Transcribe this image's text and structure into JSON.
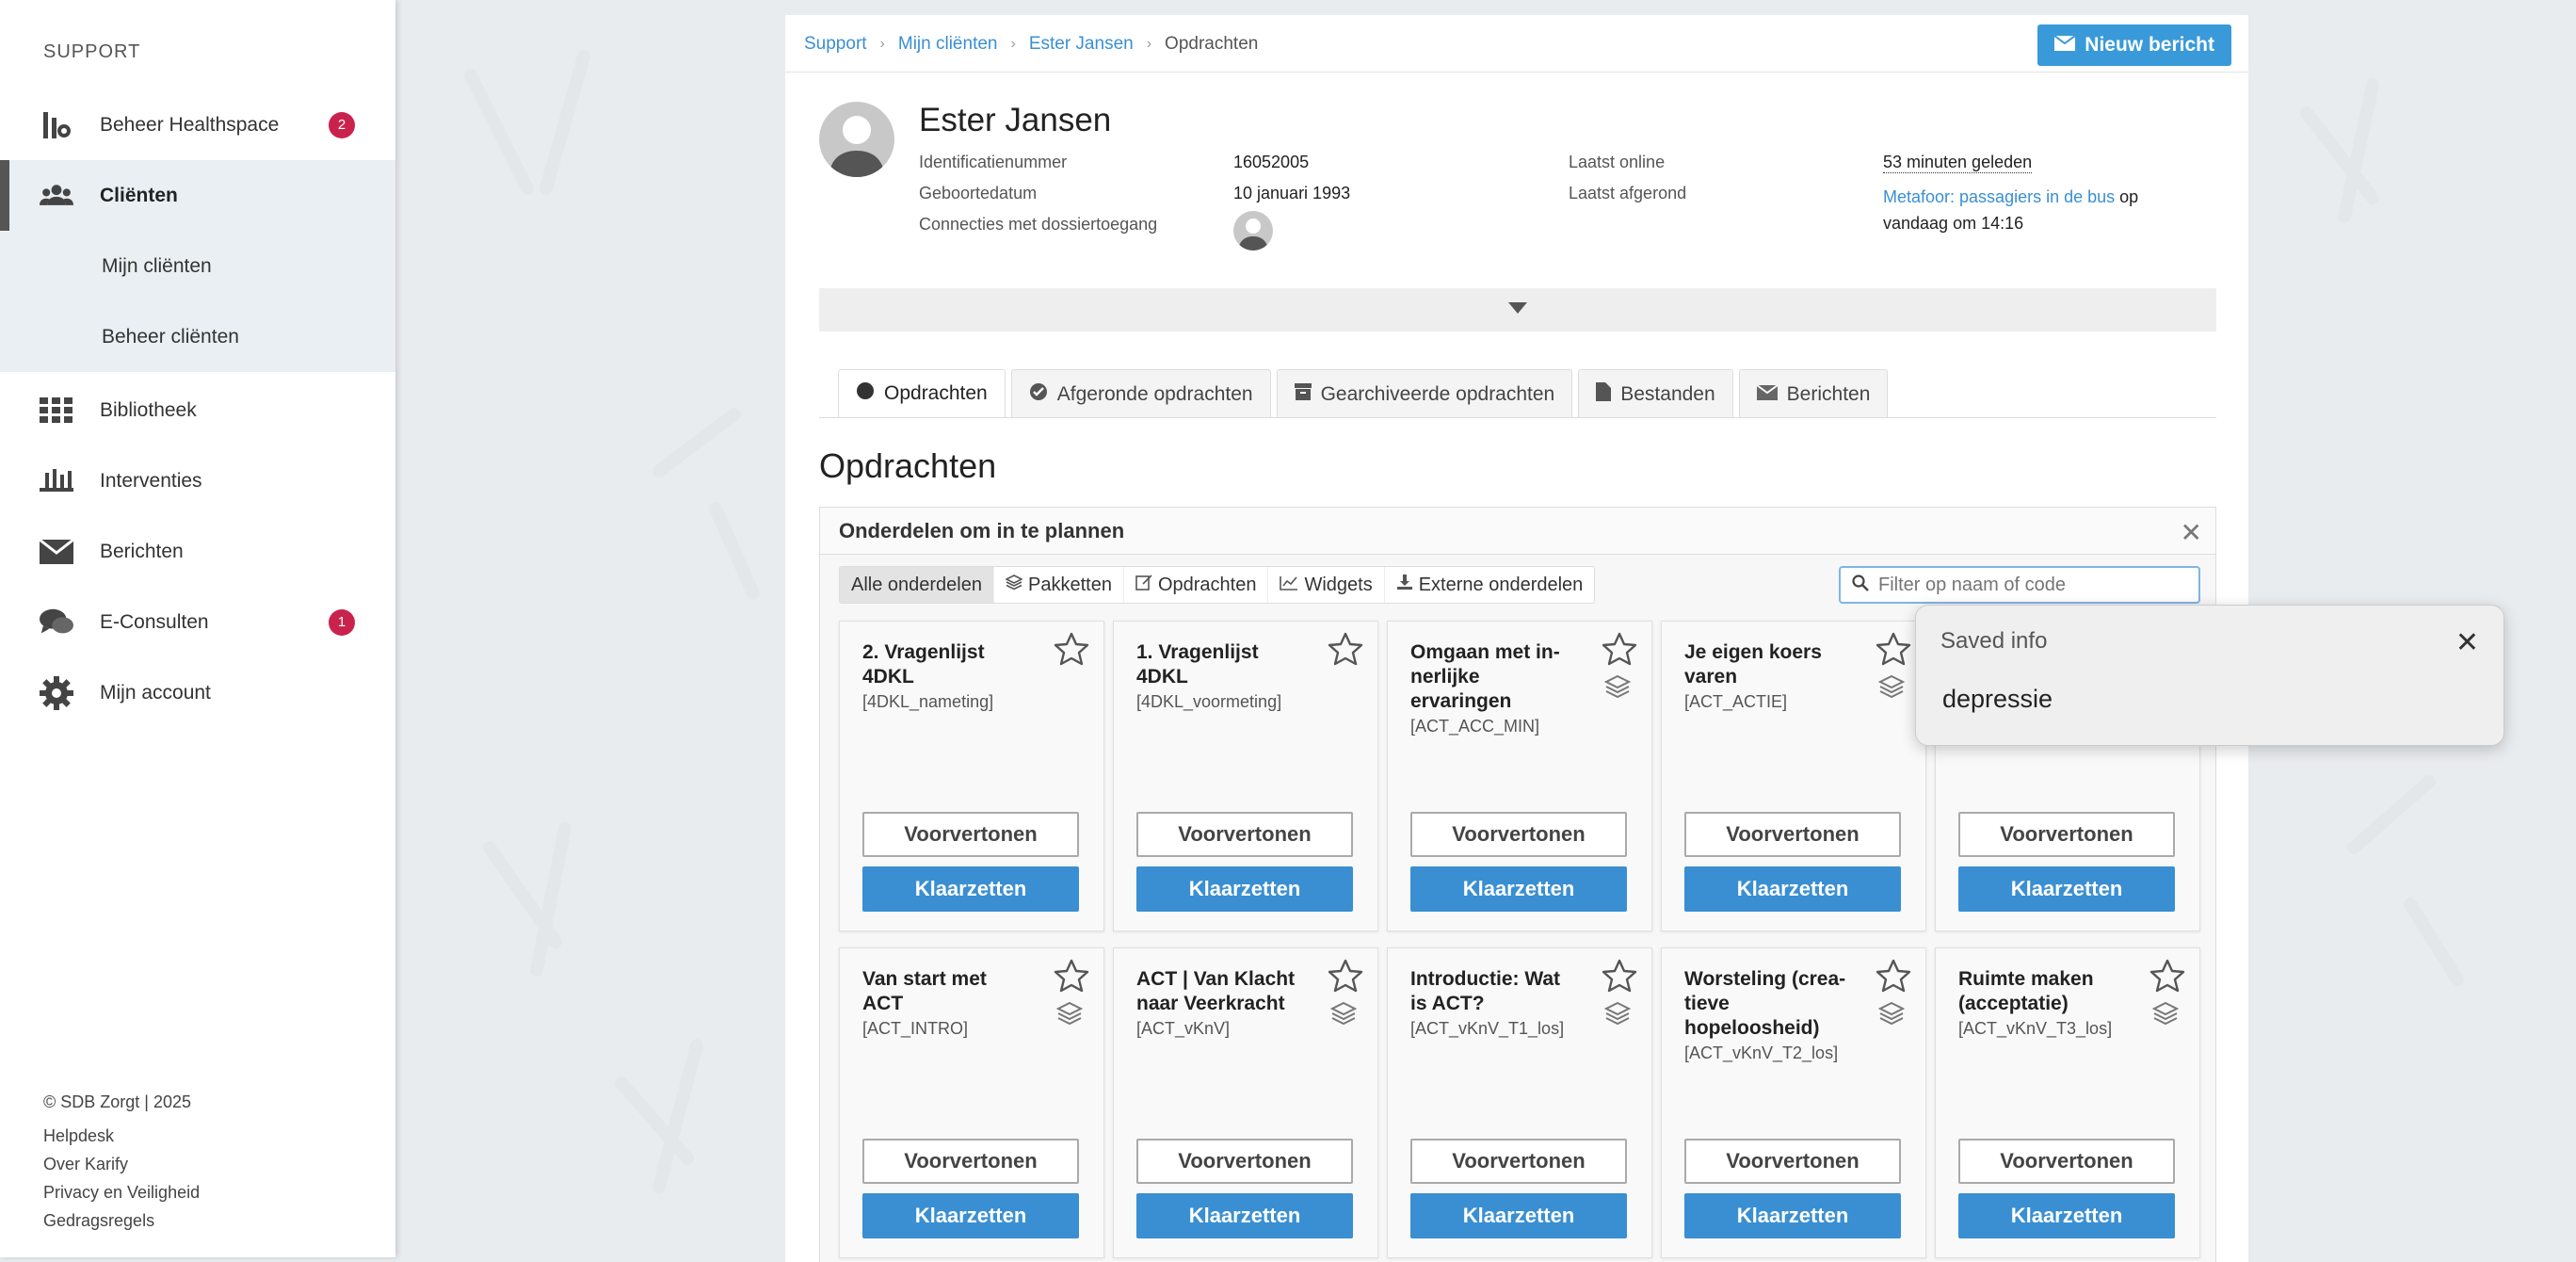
{
  "sidebar": {
    "section": "SUPPORT",
    "items": [
      {
        "label": "Beheer Healthspace",
        "badge": "2"
      },
      {
        "label": "Cliënten"
      },
      {
        "label": "Mijn cliënten"
      },
      {
        "label": "Beheer cliënten"
      },
      {
        "label": "Bibliotheek"
      },
      {
        "label": "Interventies"
      },
      {
        "label": "Berichten"
      },
      {
        "label": "E-Consulten",
        "badge": "1"
      },
      {
        "label": "Mijn account"
      }
    ],
    "footer": {
      "copyright": "© SDB Zorgt | 2025",
      "links": [
        "Helpdesk",
        "Over Karify",
        "Privacy en Veiligheid",
        "Gedragsregels"
      ]
    }
  },
  "breadcrumb": [
    "Support",
    "Mijn cliënten",
    "Ester Jansen",
    "Opdrachten"
  ],
  "new_message_label": "Nieuw bericht",
  "client": {
    "name": "Ester Jansen",
    "id_label": "Identificatienummer",
    "id_value": "16052005",
    "dob_label": "Geboortedatum",
    "dob_value": "10 januari 1993",
    "connections_label": "Connecties met dossiertoegang",
    "last_online_label": "Laatst online",
    "last_online_value": "53 minuten geleden",
    "last_done_label": "Laatst afgerond",
    "last_done_link": "Metafoor: passagiers in de bus",
    "last_done_suffix": " op",
    "last_done_time": "vandaag om 14:16"
  },
  "tabs": [
    "Opdrachten",
    "Afgeronde opdrachten",
    "Gearchiveerde opdrachten",
    "Bestanden",
    "Berichten"
  ],
  "section_title": "Opdrachten",
  "panel": {
    "title": "Onderdelen om in te plannen",
    "filter_tabs": [
      "Alle onderdelen",
      "Pakketten",
      "Opdrachten",
      "Widgets",
      "Externe onderdelen"
    ],
    "search_placeholder": "Filter op naam of code"
  },
  "cards": [
    {
      "title": "2. Vragenlijst 4DKL",
      "code": "[4DKL_nameting]",
      "layers": false
    },
    {
      "title": "1. Vragenlijst 4DKL",
      "code": "[4DKL_voormeting]",
      "layers": false
    },
    {
      "title": "Omgaan met in-nerlijke ervaringen",
      "code": "[ACT_ACC_MIN]",
      "layers": true
    },
    {
      "title": "Je eigen koers varen",
      "code": "[ACT_ACTIE]",
      "layers": true
    },
    {
      "title": "",
      "code": "",
      "layers": false
    },
    {
      "title": "Van start met ACT",
      "code": "[ACT_INTRO]",
      "layers": true
    },
    {
      "title": "ACT | Van Klacht naar Veerkracht",
      "code": "[ACT_vKnV]",
      "layers": true
    },
    {
      "title": "Introductie: Wat is ACT?",
      "code": "[ACT_vKnV_T1_los]",
      "layers": true
    },
    {
      "title": "Worsteling (crea-tieve hopeloosheid)",
      "code": "[ACT_vKnV_T2_los]",
      "layers": true
    },
    {
      "title": "Ruimte maken (acceptatie)",
      "code": "[ACT_vKnV_T3_los]",
      "layers": true
    }
  ],
  "card_buttons": {
    "preview": "Voorvertonen",
    "schedule": "Klaarzetten"
  },
  "popup": {
    "title": "Saved info",
    "text": "depressie"
  }
}
